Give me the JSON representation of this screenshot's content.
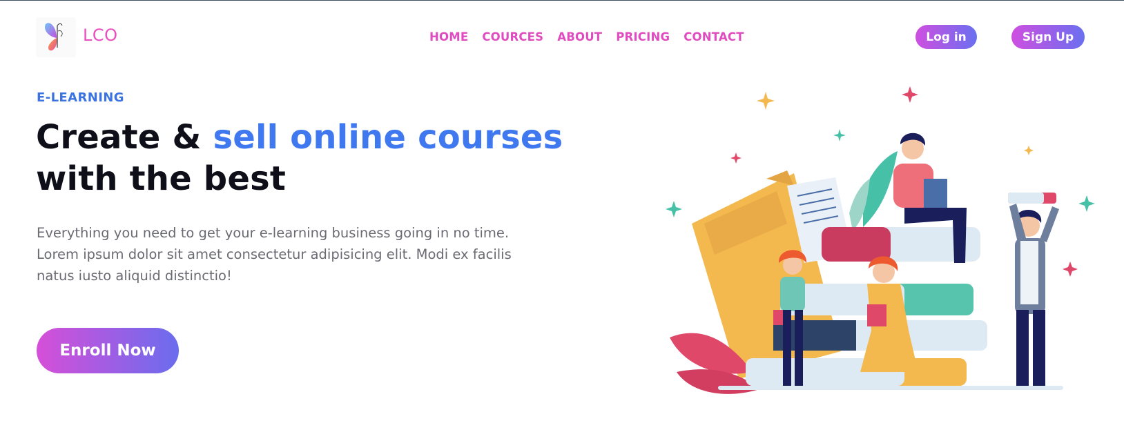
{
  "header": {
    "brand": "LCO",
    "nav": [
      "HOME",
      "COURCES",
      "ABOUT",
      "PRICING",
      "CONTACT"
    ],
    "login_label": "Log in",
    "signup_label": "Sign Up"
  },
  "hero": {
    "eyebrow": "E-LEARNING",
    "headline_part1": "Create & ",
    "headline_accent": "sell online courses",
    "headline_part2": "with the best",
    "description": "Everything you need to get your e-learning business going in no time. Lorem ipsum dolor sit amet consectetur adipisicing elit. Modi ex facilis natus iusto aliquid distinctio!",
    "cta_label": "Enroll Now"
  },
  "icons": {
    "logo": "butterfly-logo-icon",
    "illustration": "students-with-books-illustration"
  },
  "colors": {
    "brand_pink": "#e04bbf",
    "accent_blue": "#3f78ef",
    "gradient_start": "#d64fd8",
    "gradient_end": "#6b6cee"
  }
}
